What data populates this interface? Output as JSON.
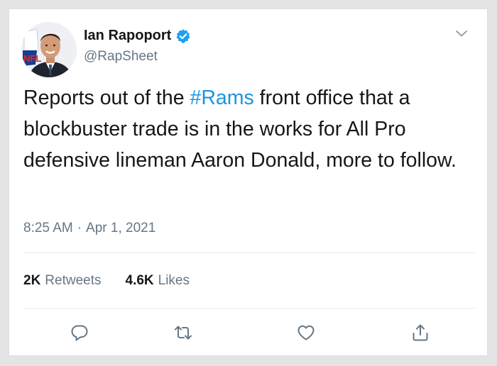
{
  "author": {
    "display_name": "Ian Rapoport",
    "handle": "@RapSheet",
    "verified": true,
    "avatar_icon": "avatar-photo",
    "avatar_logo_text": "NFL"
  },
  "menu": {
    "icon": "chevron-down-icon"
  },
  "tweet": {
    "text_before": "Reports out of the ",
    "hashtag": "#Rams",
    "text_after": " front office that a blockbuster trade is in the works for All Pro defensive lineman Aaron Donald, more to follow."
  },
  "meta": {
    "time": "8:25 AM",
    "separator": "·",
    "date": "Apr 1, 2021"
  },
  "stats": {
    "retweets_count": "2K",
    "retweets_label": "Retweets",
    "likes_count": "4.6K",
    "likes_label": "Likes"
  },
  "actions": [
    {
      "icon": "reply-icon"
    },
    {
      "icon": "retweet-icon"
    },
    {
      "icon": "like-icon"
    },
    {
      "icon": "share-icon"
    }
  ],
  "colors": {
    "link": "#1b95e0",
    "secondary_text": "#657786",
    "primary_text": "#14171a",
    "verified_badge": "#1da1f2",
    "divider": "#e6ecf0"
  }
}
